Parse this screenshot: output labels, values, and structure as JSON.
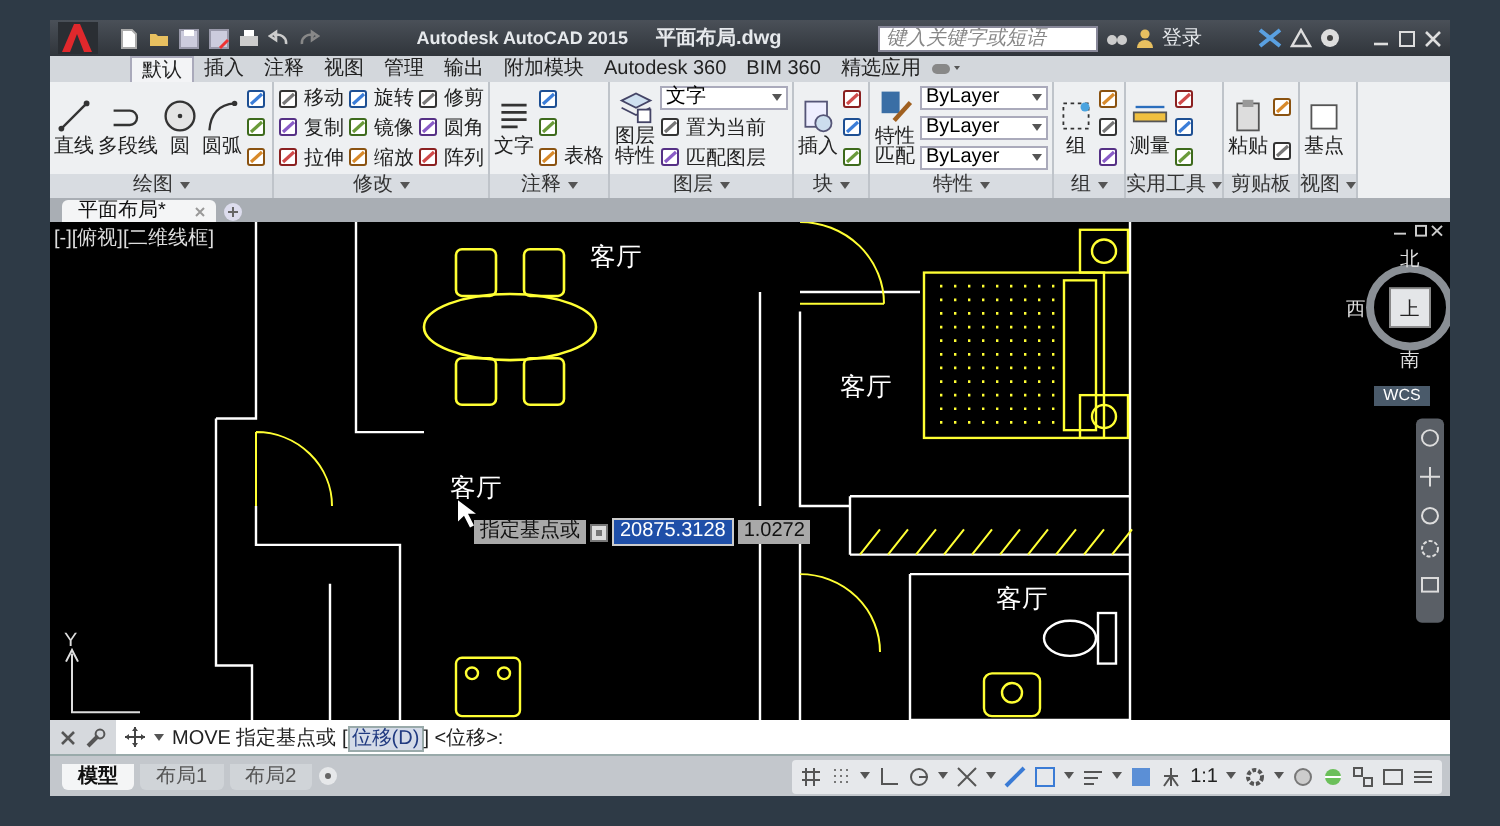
{
  "title_bar": {
    "app_name": "Autodesk AutoCAD 2015",
    "file_name": "平面布局.dwg",
    "search": {
      "placeholder": "键入关键字或短语"
    },
    "sign_in": "登录"
  },
  "ribbon_tabs": [
    {
      "label": "默认",
      "selected": true
    },
    {
      "label": "插入",
      "selected": false
    },
    {
      "label": "注释",
      "selected": false
    },
    {
      "label": "视图",
      "selected": false
    },
    {
      "label": "管理",
      "selected": false
    },
    {
      "label": "输出",
      "selected": false
    },
    {
      "label": "附加模块",
      "selected": false
    },
    {
      "label": "Autodesk 360",
      "selected": false
    },
    {
      "label": "BIM 360",
      "selected": false
    },
    {
      "label": "精选应用",
      "selected": false
    }
  ],
  "ribbon_panels": [
    {
      "title": "绘图",
      "expandable": true,
      "columns": [
        [
          {
            "kind": "large",
            "label": "直线"
          }
        ],
        [
          {
            "kind": "large",
            "label": "多段线"
          }
        ],
        [
          {
            "kind": "large",
            "label": "圆"
          }
        ],
        [
          {
            "kind": "large",
            "label": "圆弧"
          }
        ],
        [
          {
            "kind": "icon"
          },
          {
            "kind": "icon"
          },
          {
            "kind": "icon"
          }
        ]
      ]
    },
    {
      "title": "修改",
      "expandable": true,
      "columns": [
        [
          {
            "kind": "small",
            "label": "移动"
          },
          {
            "kind": "small",
            "label": "复制"
          },
          {
            "kind": "small",
            "label": "拉伸"
          }
        ],
        [
          {
            "kind": "small",
            "label": "旋转"
          },
          {
            "kind": "small",
            "label": "镜像"
          },
          {
            "kind": "small",
            "label": "缩放"
          }
        ],
        [
          {
            "kind": "small",
            "label": "修剪"
          },
          {
            "kind": "small",
            "label": "圆角"
          },
          {
            "kind": "small",
            "label": "阵列"
          }
        ]
      ]
    },
    {
      "title": "注释",
      "expandable": true,
      "columns": [
        [
          {
            "kind": "large",
            "label": "文字"
          }
        ],
        [
          {
            "kind": "icon"
          },
          {
            "kind": "icon"
          },
          {
            "kind": "small",
            "label": "表格"
          }
        ]
      ]
    },
    {
      "title": "图层",
      "expandable": true,
      "columns": [
        [
          {
            "kind": "large",
            "label": "图层特性"
          }
        ],
        [
          {
            "kind": "dropdown",
            "label": "文字"
          },
          {
            "kind": "small",
            "label": "置为当前"
          },
          {
            "kind": "small",
            "label": "匹配图层"
          }
        ]
      ]
    },
    {
      "title": "块",
      "expandable": true,
      "columns": [
        [
          {
            "kind": "large",
            "label": "插入"
          }
        ],
        [
          {
            "kind": "icon"
          },
          {
            "kind": "icon"
          },
          {
            "kind": "icon"
          }
        ]
      ]
    },
    {
      "title": "特性",
      "expandable": true,
      "columns": [
        [
          {
            "kind": "large",
            "label": "特性匹配"
          }
        ],
        [
          {
            "kind": "dropdown",
            "label": "ByLayer"
          },
          {
            "kind": "dropdown",
            "label": "ByLayer"
          },
          {
            "kind": "dropdown",
            "label": "ByLayer"
          }
        ]
      ]
    },
    {
      "title": "组",
      "expandable": true,
      "columns": [
        [
          {
            "kind": "large",
            "label": "组"
          }
        ],
        [
          {
            "kind": "icon"
          },
          {
            "kind": "icon"
          },
          {
            "kind": "icon"
          }
        ]
      ]
    },
    {
      "title": "实用工具",
      "expandable": true,
      "columns": [
        [
          {
            "kind": "large",
            "label": "测量"
          }
        ],
        [
          {
            "kind": "icon"
          },
          {
            "kind": "icon"
          },
          {
            "kind": "icon"
          }
        ]
      ]
    },
    {
      "title": "剪贴板",
      "expandable": false,
      "columns": [
        [
          {
            "kind": "large",
            "label": "粘贴"
          }
        ],
        [
          {
            "kind": "icon"
          },
          {
            "kind": "icon"
          }
        ]
      ]
    },
    {
      "title": "视图",
      "expandable": true,
      "columns": [
        [
          {
            "kind": "large",
            "label": "基点"
          }
        ]
      ]
    }
  ],
  "document_tabs": [
    {
      "label": "平面布局*",
      "selected": true
    }
  ],
  "viewport": {
    "label": "[-][俯视][二维线框]",
    "room_labels": [
      "客厅",
      "客厅",
      "客厅",
      "客厅"
    ],
    "viewcube": {
      "north": "北",
      "south": "南",
      "west": "西",
      "face": "上",
      "coordinate_system": "WCS"
    },
    "ucs_axis": "Y",
    "input_tooltip": {
      "prompt": "指定基点或",
      "x_value": "20875.3128",
      "y_value": "1.0272"
    }
  },
  "command_line": {
    "prefix": "MOVE 指定基点或 [",
    "option": "位移(D)",
    "suffix": "] <位移>:"
  },
  "layout_tabs": [
    {
      "label": "模型",
      "selected": true
    },
    {
      "label": "布局1",
      "selected": false
    },
    {
      "label": "布局2",
      "selected": false
    }
  ],
  "status_bar": {
    "scale": "1:1"
  }
}
